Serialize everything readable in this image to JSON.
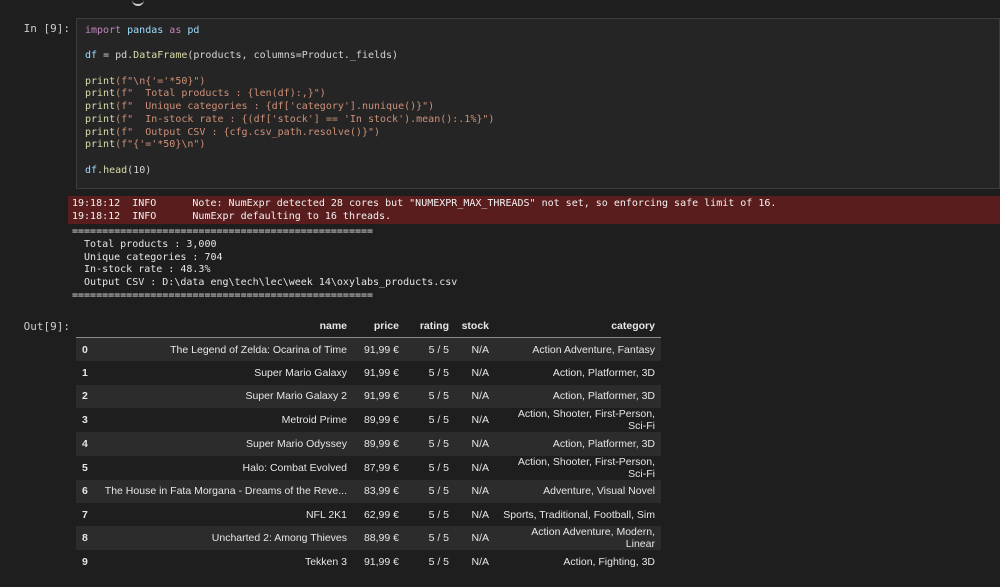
{
  "cell_in": {
    "prompt": "In [9]:",
    "code": [
      [
        {
          "t": "import",
          "c": "kw"
        },
        {
          "t": " pandas ",
          "c": "id"
        },
        {
          "t": "as",
          "c": "kw"
        },
        {
          "t": " pd",
          "c": "id"
        }
      ],
      [],
      [
        {
          "t": "df",
          "c": "id"
        },
        {
          "t": " = pd.",
          "c": "op"
        },
        {
          "t": "DataFrame",
          "c": "fn"
        },
        {
          "t": "(products, columns=Product._fields)",
          "c": "op"
        }
      ],
      [],
      [
        {
          "t": "print",
          "c": "fn"
        },
        {
          "t": "(f\"\\n{'='*50}\")",
          "c": "str"
        }
      ],
      [
        {
          "t": "print",
          "c": "fn"
        },
        {
          "t": "(f\"  Total products : {len(df):,}\")",
          "c": "str"
        }
      ],
      [
        {
          "t": "print",
          "c": "fn"
        },
        {
          "t": "(f\"  Unique categories : {df['category'].nunique()}\")",
          "c": "str"
        }
      ],
      [
        {
          "t": "print",
          "c": "fn"
        },
        {
          "t": "(f\"  In-stock rate : {(df['stock'] == 'In stock').mean():.1%}\")",
          "c": "str"
        }
      ],
      [
        {
          "t": "print",
          "c": "fn"
        },
        {
          "t": "(f\"  Output CSV : {cfg.csv_path.resolve()}\")",
          "c": "str"
        }
      ],
      [
        {
          "t": "print",
          "c": "fn"
        },
        {
          "t": "(f\"{'='*50}\\n\")",
          "c": "str"
        }
      ],
      [],
      [
        {
          "t": "df",
          "c": "id"
        },
        {
          "t": ".",
          "c": "op"
        },
        {
          "t": "head",
          "c": "fn"
        },
        {
          "t": "(10)",
          "c": "op"
        }
      ]
    ]
  },
  "stderr": {
    "lines": [
      "19:18:12  INFO      Note: NumExpr detected 28 cores but \"NUMEXPR_MAX_THREADS\" not set, so enforcing safe limit of 16.",
      "19:18:12  INFO      NumExpr defaulting to 16 threads."
    ]
  },
  "stdout": {
    "lines": [
      "==================================================",
      "  Total products : 3,000",
      "  Unique categories : 704",
      "  In-stock rate : 48.3%",
      "  Output CSV : D:\\data eng\\tech\\lec\\week 14\\oxylabs_products.csv",
      "=================================================="
    ]
  },
  "cell_out": {
    "prompt": "Out[9]:",
    "columns": [
      "",
      "name",
      "price",
      "rating",
      "stock",
      "category"
    ],
    "rows": [
      [
        "0",
        "The Legend of Zelda: Ocarina of Time",
        "91,99 €",
        "5 / 5",
        "N/A",
        "Action Adventure, Fantasy"
      ],
      [
        "1",
        "Super Mario Galaxy",
        "91,99 €",
        "5 / 5",
        "N/A",
        "Action, Platformer, 3D"
      ],
      [
        "2",
        "Super Mario Galaxy 2",
        "91,99 €",
        "5 / 5",
        "N/A",
        "Action, Platformer, 3D"
      ],
      [
        "3",
        "Metroid Prime",
        "89,99 €",
        "5 / 5",
        "N/A",
        "Action, Shooter, First-Person, Sci-Fi"
      ],
      [
        "4",
        "Super Mario Odyssey",
        "89,99 €",
        "5 / 5",
        "N/A",
        "Action, Platformer, 3D"
      ],
      [
        "5",
        "Halo: Combat Evolved",
        "87,99 €",
        "5 / 5",
        "N/A",
        "Action, Shooter, First-Person, Sci-Fi"
      ],
      [
        "6",
        "The House in Fata Morgana - Dreams of the Reve...",
        "83,99 €",
        "5 / 5",
        "N/A",
        "Adventure, Visual Novel"
      ],
      [
        "7",
        "NFL 2K1",
        "62,99 €",
        "5 / 5",
        "N/A",
        "Sports, Traditional, Football, Sim"
      ],
      [
        "8",
        "Uncharted 2: Among Thieves",
        "88,99 €",
        "5 / 5",
        "N/A",
        "Action Adventure, Modern, Linear"
      ],
      [
        "9",
        "Tekken 3",
        "91,99 €",
        "5 / 5",
        "N/A",
        "Action, Fighting, 3D"
      ]
    ]
  }
}
